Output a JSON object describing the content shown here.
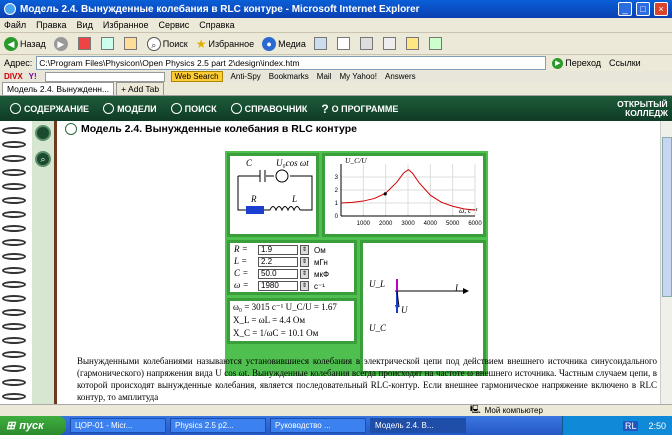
{
  "window": {
    "title": "Модель 2.4. Вынужденные колебания в RLC контуре - Microsoft Internet Explorer"
  },
  "menu": [
    "Файл",
    "Правка",
    "Вид",
    "Избранное",
    "Сервис",
    "Справка"
  ],
  "toolbar": {
    "back": "Назад",
    "search": "Поиск",
    "favorites": "Избранное",
    "media": "Медиа"
  },
  "address": {
    "label": "Адрес:",
    "value": "C:\\Program Files\\Physicon\\Open Physics 2.5 part 2\\design\\index.htm",
    "go": "Переход",
    "links": "Ссылки"
  },
  "divx": {
    "logo": "DIVX",
    "y": "Y!",
    "web_search": "Web Search",
    "anti_spy": "Anti-Spy",
    "bookmarks": "Bookmarks",
    "mail": "Mail",
    "my_yahoo": "My Yahoo!",
    "answers": "Answers"
  },
  "tabs": {
    "current": "Модель 2.4. Вынужденн...",
    "add": "Add Tab"
  },
  "appnav": {
    "items": [
      "СОДЕРЖАНИЕ",
      "МОДЕЛИ",
      "ПОИСК",
      "СПРАВОЧНИК",
      "О ПРОГРАММЕ"
    ],
    "brand_line1": "ОТКРЫТЫЙ",
    "brand_line2": "КОЛЛЕДЖ"
  },
  "page": {
    "heading": "Модель 2.4. Вынужденные колебания в RLC контуре"
  },
  "circuit": {
    "c": "C",
    "source": "U₀cos ωt",
    "r": "R",
    "l": "L"
  },
  "graph": {
    "ylabel": "U_C/U",
    "xlabel": "ω, c⁻¹",
    "y_ticks": [
      "3",
      "2",
      "1",
      "0"
    ],
    "x_ticks": [
      "1000",
      "2000",
      "3000",
      "4000",
      "5000",
      "6000"
    ]
  },
  "chart_data": {
    "type": "line",
    "title": "",
    "xlabel": "ω, c⁻¹",
    "ylabel": "U_C/U",
    "xlim": [
      0,
      6000
    ],
    "ylim": [
      0,
      4
    ],
    "series": [
      {
        "x": [
          0,
          500,
          1000,
          1500,
          2000,
          2500,
          2800,
          3015,
          3200,
          3500,
          4000,
          4500,
          5000,
          5500,
          6000
        ],
        "values": [
          1.0,
          1.05,
          1.15,
          1.35,
          1.75,
          2.6,
          3.3,
          3.57,
          3.3,
          2.55,
          1.6,
          1.05,
          0.75,
          0.55,
          0.45
        ]
      }
    ],
    "marker": {
      "x": 1980,
      "y": 1.7
    }
  },
  "params": [
    {
      "label": "R =",
      "value": "1.9",
      "unit": "Ом"
    },
    {
      "label": "L =",
      "value": "2.2",
      "unit": "мГн"
    },
    {
      "label": "C =",
      "value": "50.0",
      "unit": "мкФ"
    },
    {
      "label": "ω =",
      "value": "1980",
      "unit": "c⁻¹"
    }
  ],
  "results": {
    "line1": "ω₀ = 3015 c⁻¹   U_C/U = 1.67",
    "line2": "X_L = ωL = 4.4  Ом",
    "line3": "X_C = 1/ωC = 10.1  Ом"
  },
  "phasor": {
    "ul": "U_L",
    "uc": "U_C",
    "u": "U",
    "i": "I"
  },
  "paragraph": "Вынужденными колебаниями называются установившиеся колебания в электрической цепи под действием внешнего источника синусоидального (гармонического) напряжения вида U cos ωt. Вынужденные колебания всегда происходят на частоте ω внешнего источника. Частным случаем цепи, в которой происходят вынужденные колебания, является последовательный RLC-контур. Если внешнее гармоническое напряжение включено в RLC контур, то амплитуда",
  "status": {
    "right": "Мой компьютер"
  },
  "taskbar": {
    "start": "пуск",
    "tasks": [
      "ЦОР-01 - Micr...",
      "Physics 2.5 p2...",
      "Руководство ...",
      "Модель 2.4. В..."
    ],
    "lang": "RL",
    "time": "2:50"
  }
}
